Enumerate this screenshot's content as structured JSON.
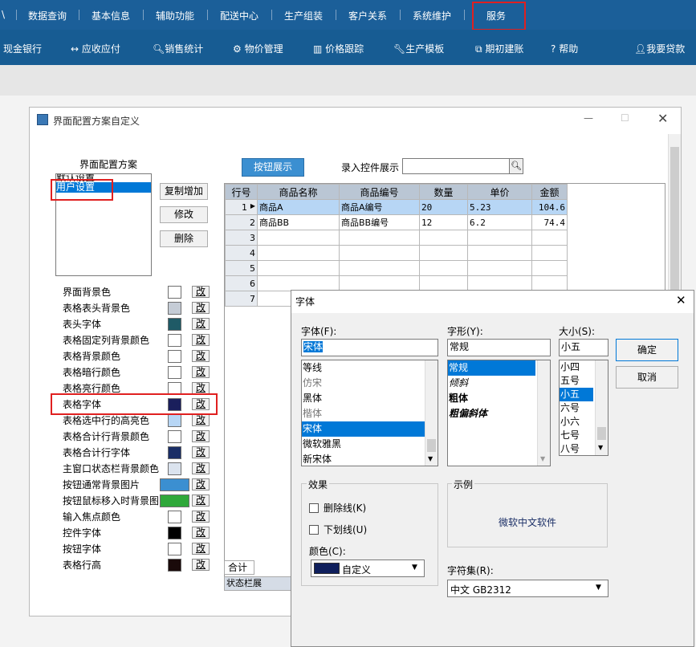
{
  "topnav": {
    "items": [
      "\\",
      "数据查询",
      "基本信息",
      "辅助功能",
      "配送中心",
      "生产组装",
      "客户关系",
      "系统维护",
      "服务"
    ]
  },
  "subnav": {
    "items": [
      "现金银行",
      "应收应付",
      "销售统计",
      "物价管理",
      "价格跟踪",
      "生产模板",
      "期初建账",
      "帮助",
      "我要贷款"
    ]
  },
  "win1": {
    "title": "界面配置方案自定义",
    "scheme_label": "界面配置方案",
    "schemes": [
      "默认设置",
      "用户设置"
    ],
    "buttons": {
      "copy": "复制增加",
      "modify": "修改",
      "delete": "删除"
    },
    "tab_button": "按钮展示",
    "input_ctrl_label": "录入控件展示",
    "color_items": [
      {
        "label": "界面背景色",
        "color": "#ffffff"
      },
      {
        "label": "表格表头背景色",
        "color": "#c5ccd6"
      },
      {
        "label": "表头字体",
        "color": "#1f5a66"
      },
      {
        "label": "表格固定列背景颜色",
        "color": "#ffffff"
      },
      {
        "label": "表格背景颜色",
        "color": "#ffffff"
      },
      {
        "label": "表格暗行颜色",
        "color": "#ffffff"
      },
      {
        "label": "表格亮行颜色",
        "color": "#ffffff"
      },
      {
        "label": "表格字体",
        "color": "#1a1f5c"
      },
      {
        "label": "表格选中行的高亮色",
        "color": "#b7d6f5"
      },
      {
        "label": "表格合计行背景颜色",
        "color": "#ffffff"
      },
      {
        "label": "表格合计行字体",
        "color": "#1a2e66"
      },
      {
        "label": "主窗口状态栏背景颜色",
        "color": "#dbe3ee"
      },
      {
        "label": "按钮通常背景图片",
        "color": "#3b8fd1"
      },
      {
        "label": "按钮鼠标移入时背景图",
        "color": "#2fa83a"
      },
      {
        "label": "输入焦点颜色",
        "color": "#ffffff"
      },
      {
        "label": "控件字体",
        "color": "#000000"
      },
      {
        "label": "按钮字体",
        "color": "#ffffff"
      },
      {
        "label": "表格行高",
        "color": "#1a0a0a"
      }
    ],
    "change_label": "改",
    "grid": {
      "headers": [
        "行号",
        "商品名称",
        "商品编号",
        "数量",
        "单价",
        "金额"
      ],
      "rows": [
        [
          "1",
          "商品A",
          "商品A编号",
          "20",
          "5.23",
          "104.6"
        ],
        [
          "2",
          "商品BB",
          "商品BB编号",
          "12",
          "6.2",
          "74.4"
        ],
        [
          "3",
          "",
          "",
          "",
          "",
          ""
        ],
        [
          "4",
          "",
          "",
          "",
          "",
          ""
        ],
        [
          "5",
          "",
          "",
          "",
          "",
          ""
        ],
        [
          "6",
          "",
          "",
          "",
          "",
          ""
        ],
        [
          "7",
          "",
          "",
          "",
          "",
          ""
        ]
      ],
      "total_label": "合计",
      "status_label": "状态栏展"
    }
  },
  "fontdlg": {
    "title": "字体",
    "font_label": "字体(F):",
    "font_value": "宋体",
    "fonts": [
      "等线",
      "仿宋",
      "黑体",
      "楷体",
      "宋体",
      "微软雅黑",
      "新宋体"
    ],
    "style_label": "字形(Y):",
    "style_value": "常规",
    "styles": [
      "常规",
      "倾斜",
      "粗体",
      "粗偏斜体"
    ],
    "size_label": "大小(S):",
    "size_value": "小五",
    "sizes": [
      "小四",
      "五号",
      "小五",
      "六号",
      "小六",
      "七号",
      "八号"
    ],
    "ok": "确定",
    "cancel": "取消",
    "effects_label": "效果",
    "strike_label": "删除线(K)",
    "underline_label": "下划线(U)",
    "color_label": "颜色(C):",
    "color_value": "自定义",
    "color_hex": "#0f1f5c",
    "sample_label": "示例",
    "sample_text": "微软中文软件",
    "charset_label": "字符集(R):",
    "charset_value": "中文 GB2312"
  }
}
